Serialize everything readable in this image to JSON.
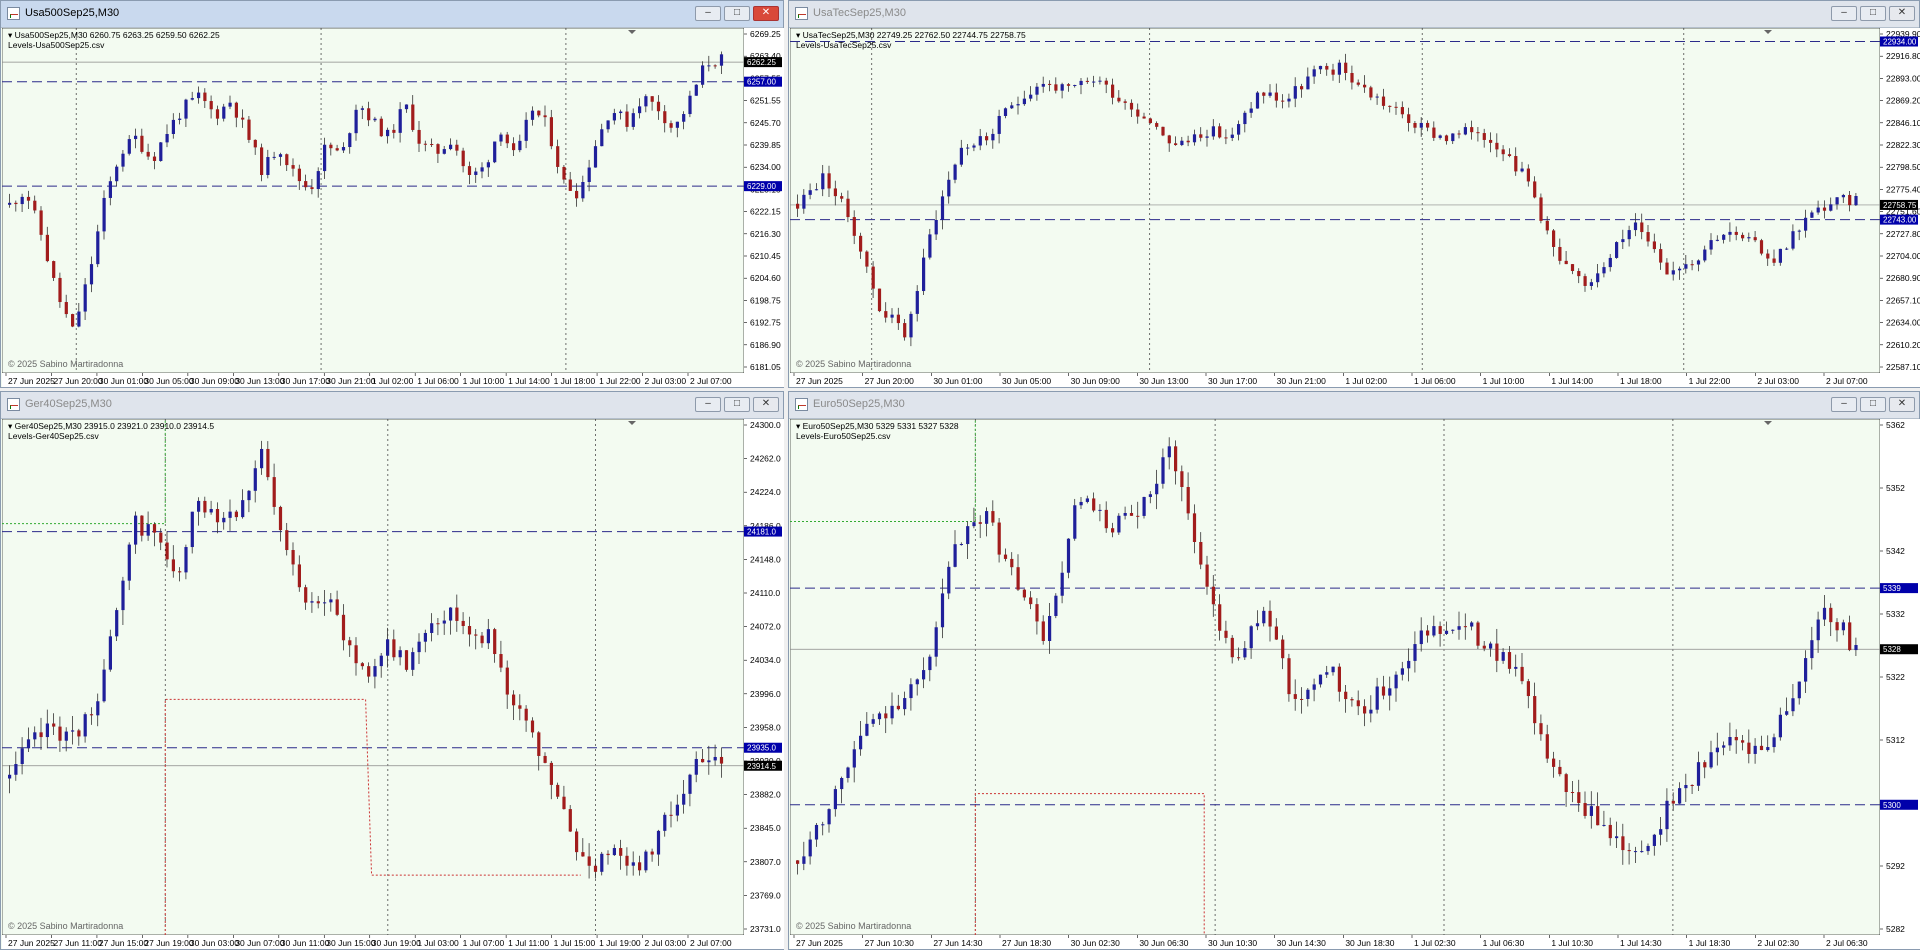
{
  "windows": [
    {
      "id": "w1",
      "title": "Usa500Sep25,M30",
      "active": true,
      "header_line": "Usa500Sep25,M30  6260.75 6263.25 6259.50 6262.25",
      "levels_label": "Levels-Usa500Sep25.csv",
      "copyright": "© 2025 Sabino Martiradonna",
      "price_ticks": [
        "6269.25",
        "6263.40",
        "6257.55",
        "6251.55",
        "6245.70",
        "6239.85",
        "6234.00",
        "6228.15",
        "6222.15",
        "6216.30",
        "6210.45",
        "6204.60",
        "6198.75",
        "6192.75",
        "6186.90",
        "6181.05"
      ],
      "time_ticks": [
        "27 Jun 2025",
        "27 Jun 20:00",
        "30 Jun 01:00",
        "30 Jun 05:00",
        "30 Jun 09:00",
        "30 Jun 13:00",
        "30 Jun 17:00",
        "30 Jun 21:00",
        "1 Jul 02:00",
        "1 Jul 06:00",
        "1 Jul 10:00",
        "1 Jul 14:00",
        "1 Jul 18:00",
        "1 Jul 22:00",
        "2 Jul 03:00",
        "2 Jul 07:00"
      ],
      "price_tags": [
        {
          "text": "6262.25",
          "color": "#000000"
        },
        {
          "text": "6257.00",
          "color": "#0000aa"
        },
        {
          "text": "6229.00",
          "color": "#0000aa"
        }
      ]
    },
    {
      "id": "w2",
      "title": "UsaTecSep25,M30",
      "active": false,
      "header_line": "UsaTecSep25,M30  22749.25 22762.50 22744.75 22758.75",
      "levels_label": "Levels-UsaTecSep25.csv",
      "copyright": "© 2025 Sabino Martiradonna",
      "price_ticks": [
        "22939.90",
        "22916.80",
        "22893.00",
        "22869.20",
        "22846.10",
        "22822.30",
        "22798.50",
        "22775.40",
        "22751.60",
        "22727.80",
        "22704.00",
        "22680.90",
        "22657.10",
        "22634.00",
        "22610.20",
        "22587.10"
      ],
      "time_ticks": [
        "27 Jun 2025",
        "27 Jun 20:00",
        "30 Jun 01:00",
        "30 Jun 05:00",
        "30 Jun 09:00",
        "30 Jun 13:00",
        "30 Jun 17:00",
        "30 Jun 21:00",
        "1 Jul 02:00",
        "1 Jul 06:00",
        "1 Jul 10:00",
        "1 Jul 14:00",
        "1 Jul 18:00",
        "1 Jul 22:00",
        "2 Jul 03:00",
        "2 Jul 07:00"
      ],
      "price_tags": [
        {
          "text": "22934.00",
          "color": "#0000aa"
        },
        {
          "text": "22758.75",
          "color": "#000000"
        },
        {
          "text": "22743.00",
          "color": "#0000aa"
        }
      ]
    },
    {
      "id": "w3",
      "title": "Ger40Sep25,M30",
      "active": false,
      "header_line": "Ger40Sep25,M30  23915.0 23921.0 23910.0 23914.5",
      "levels_label": "Levels-Ger40Sep25.csv",
      "copyright": "© 2025 Sabino Martiradonna",
      "price_ticks": [
        "24300.0",
        "24262.0",
        "24224.0",
        "24186.0",
        "24148.0",
        "24110.0",
        "24072.0",
        "24034.0",
        "23996.0",
        "23958.0",
        "23920.0",
        "23882.0",
        "23845.0",
        "23807.0",
        "23769.0",
        "23731.0"
      ],
      "time_ticks": [
        "27 Jun 2025",
        "27 Jun 11:00",
        "27 Jun 15:00",
        "27 Jun 19:00",
        "30 Jun 03:00",
        "30 Jun 07:00",
        "30 Jun 11:00",
        "30 Jun 15:00",
        "30 Jun 19:00",
        "1 Jul 03:00",
        "1 Jul 07:00",
        "1 Jul 11:00",
        "1 Jul 15:00",
        "1 Jul 19:00",
        "2 Jul 03:00",
        "2 Jul 07:00"
      ],
      "price_tags": [
        {
          "text": "24181.0",
          "color": "#0000aa"
        },
        {
          "text": "23935.0",
          "color": "#0000aa"
        },
        {
          "text": "23914.5",
          "color": "#000000"
        }
      ]
    },
    {
      "id": "w4",
      "title": "Euro50Sep25,M30",
      "active": false,
      "header_line": "Euro50Sep25,M30  5329 5331 5327 5328",
      "levels_label": "Levels-Euro50Sep25.csv",
      "copyright": "© 2025 Sabino Martiradonna",
      "price_ticks": [
        "5362",
        "5352",
        "5342",
        "5332",
        "5322",
        "5312",
        "5302",
        "5292",
        "5282"
      ],
      "time_ticks": [
        "27 Jun 2025",
        "27 Jun 10:30",
        "27 Jun 14:30",
        "27 Jun 18:30",
        "30 Jun 02:30",
        "30 Jun 06:30",
        "30 Jun 10:30",
        "30 Jun 14:30",
        "30 Jun 18:30",
        "1 Jul 02:30",
        "1 Jul 06:30",
        "1 Jul 10:30",
        "1 Jul 14:30",
        "1 Jul 18:30",
        "2 Jul 02:30",
        "2 Jul 06:30"
      ],
      "price_tags": [
        {
          "text": "5339",
          "color": "#0000aa"
        },
        {
          "text": "5328",
          "color": "#000000"
        },
        {
          "text": "5300",
          "color": "#0000aa"
        }
      ]
    }
  ],
  "colors": {
    "bull": "#1f1f9a",
    "bear": "#a11c1c",
    "level_line": "#2b2b8a",
    "red_dotted": "#cc3333",
    "green_dotted": "#33aa33",
    "chart_bg": "#f3fbf1"
  },
  "chart_data": [
    {
      "type": "candlestick",
      "title": "Usa500Sep25,M30",
      "ylim": [
        6181.05,
        6269.25
      ],
      "levels": [
        6257.0,
        6229.0
      ],
      "last": 6262.25,
      "close_path": [
        6224,
        6228,
        6216,
        6200,
        6190,
        6205,
        6225,
        6238,
        6242,
        6236,
        6244,
        6250,
        6253,
        6248,
        6252,
        6243,
        6233,
        6240,
        6232,
        6228,
        6240,
        6237,
        6252,
        6246,
        6242,
        6251,
        6240,
        6238,
        6242,
        6231,
        6234,
        6245,
        6236,
        6250,
        6245,
        6230,
        6227,
        6240,
        6250,
        6246,
        6253,
        6250,
        6244,
        6252,
        6262,
        6263
      ]
    },
    {
      "type": "candlestick",
      "title": "UsaTecSep25,M30",
      "ylim": [
        22587.1,
        22939.9
      ],
      "levels": [
        22934.0,
        22743.0
      ],
      "last": 22758.75,
      "close_path": [
        22760,
        22790,
        22740,
        22650,
        22620,
        22740,
        22820,
        22830,
        22870,
        22890,
        22880,
        22895,
        22870,
        22850,
        22820,
        22840,
        22830,
        22880,
        22870,
        22900,
        22905,
        22880,
        22860,
        22840,
        22830,
        22840,
        22820,
        22780,
        22700,
        22670,
        22710,
        22740,
        22690,
        22700,
        22730,
        22720,
        22700,
        22740,
        22760,
        22765
      ]
    },
    {
      "type": "candlestick",
      "title": "Ger40Sep25,M30",
      "ylim": [
        23731.0,
        24300.0
      ],
      "levels": [
        24181.0,
        23935.0
      ],
      "last": 23914.5,
      "close_path": [
        23900,
        23940,
        23960,
        23945,
        23980,
        24070,
        24190,
        24180,
        24120,
        24220,
        24200,
        24210,
        24270,
        24170,
        24110,
        24110,
        24060,
        24020,
        24050,
        24030,
        24080,
        24090,
        24070,
        24060,
        23990,
        23940,
        23890,
        23820,
        23800,
        23830,
        23790,
        23840,
        23880,
        23920,
        23914
      ]
    },
    {
      "type": "candlestick",
      "title": "Euro50Sep25,M30",
      "ylim": [
        5278,
        5368
      ],
      "levels": [
        5339,
        5300
      ],
      "last": 5328,
      "close_path": [
        5290,
        5300,
        5312,
        5318,
        5322,
        5345,
        5353,
        5340,
        5330,
        5355,
        5350,
        5352,
        5365,
        5342,
        5326,
        5335,
        5318,
        5325,
        5316,
        5322,
        5330,
        5333,
        5330,
        5325,
        5310,
        5300,
        5296,
        5290,
        5300,
        5307,
        5312,
        5310,
        5320,
        5336,
        5328
      ]
    }
  ]
}
